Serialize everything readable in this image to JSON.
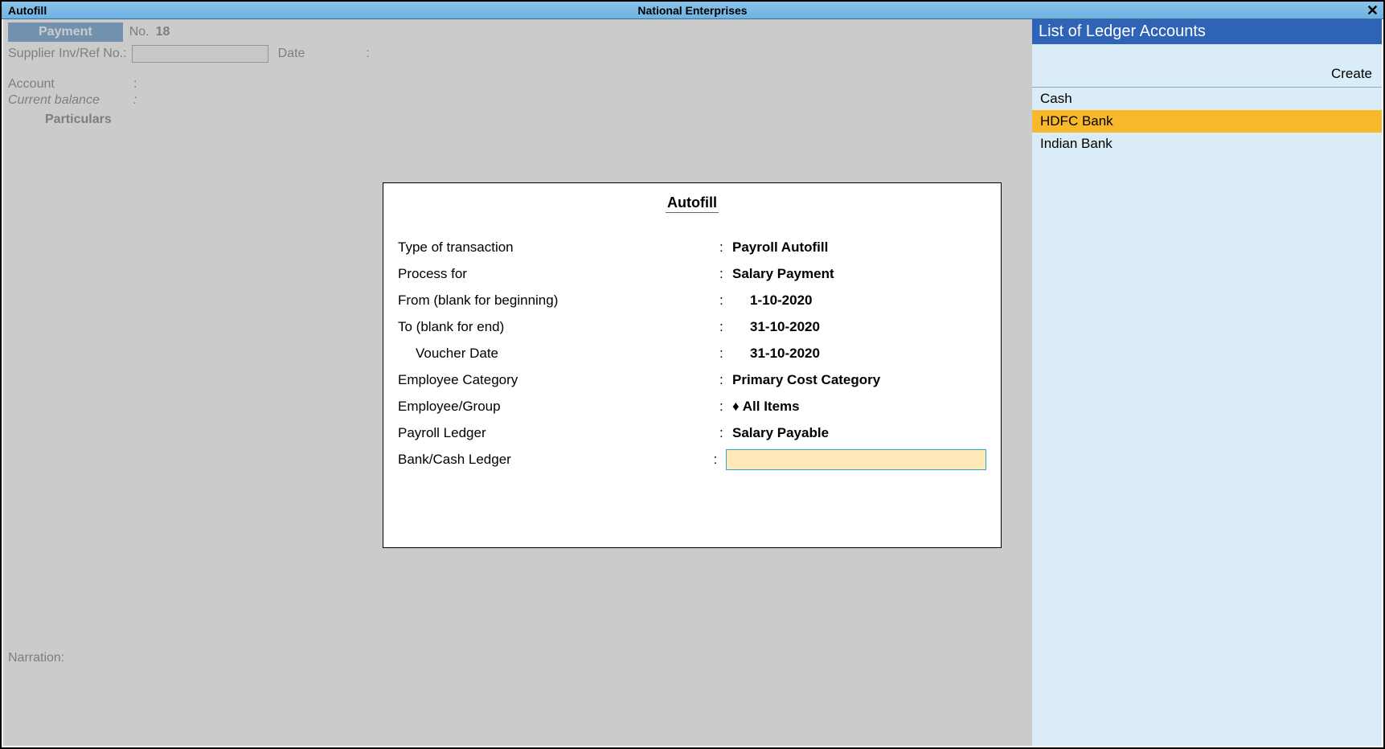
{
  "titlebar": {
    "left": "Autofill",
    "center": "National Enterprises",
    "close": "✕"
  },
  "voucher": {
    "type": "Payment",
    "no_label": "No.",
    "no_value": "18",
    "ref_label": "Supplier Inv/Ref No.:",
    "date_label": "Date",
    "account_label": "Account",
    "balance_label": "Current balance",
    "particulars": "Particulars",
    "narration": "Narration:"
  },
  "autofill": {
    "title": "Autofill",
    "rows": {
      "type_label": "Type of transaction",
      "type_value": "Payroll Autofill",
      "process_label": "Process for",
      "process_value": "Salary Payment",
      "from_label": "From (blank for beginning)",
      "from_value": "1-10-2020",
      "to_label": "To (blank for end)",
      "to_value": "31-10-2020",
      "vdate_label": "Voucher Date",
      "vdate_value": "31-10-2020",
      "empcat_label": "Employee Category",
      "empcat_value": "Primary Cost Category",
      "empgrp_label": "Employee/Group",
      "empgrp_value": "♦ All Items",
      "payledger_label": "Payroll Ledger",
      "payledger_value": "Salary Payable",
      "bank_label": "Bank/Cash Ledger",
      "bank_value": ""
    }
  },
  "ledger_panel": {
    "title": "List of Ledger Accounts",
    "create": "Create",
    "items": [
      {
        "label": "Cash",
        "selected": false
      },
      {
        "label": "HDFC Bank",
        "selected": true
      },
      {
        "label": "Indian Bank",
        "selected": false
      }
    ]
  }
}
